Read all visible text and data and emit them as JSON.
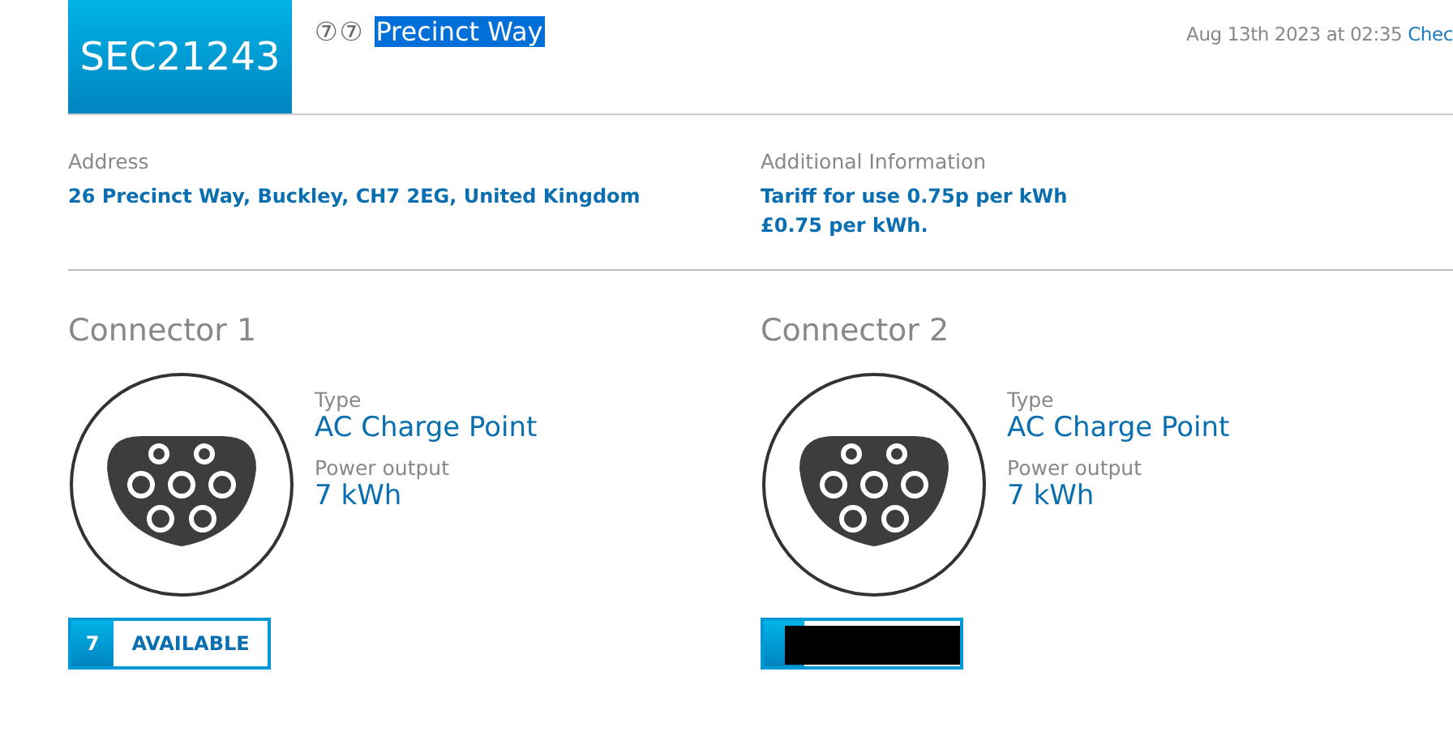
{
  "header": {
    "code": "SEC21243",
    "badges": [
      "⑦",
      "⑦"
    ],
    "title": "Precinct Way",
    "title_selected": true,
    "date": "Aug 13th 2023 at 02:35",
    "link": "Chec"
  },
  "info": [
    {
      "label": "Address",
      "lines": [
        "26 Precinct Way, Buckley, CH7 2EG, United Kingdom"
      ]
    },
    {
      "label": "Additional Information",
      "lines": [
        "Tariff for use 0.75p per kWh",
        "£0.75 per kWh."
      ]
    }
  ],
  "connectors": [
    {
      "name": "Connector 1",
      "type_label": "Type",
      "type": "AC Charge Point",
      "power_label": "Power output",
      "power": "7 kWh",
      "status": {
        "number": "7",
        "text": "AVAILABLE",
        "redacted": false
      }
    },
    {
      "name": "Connector 2",
      "type_label": "Type",
      "type": "AC Charge Point",
      "power_label": "Power output",
      "power": "7 kWh",
      "status": {
        "redacted": true
      }
    }
  ]
}
